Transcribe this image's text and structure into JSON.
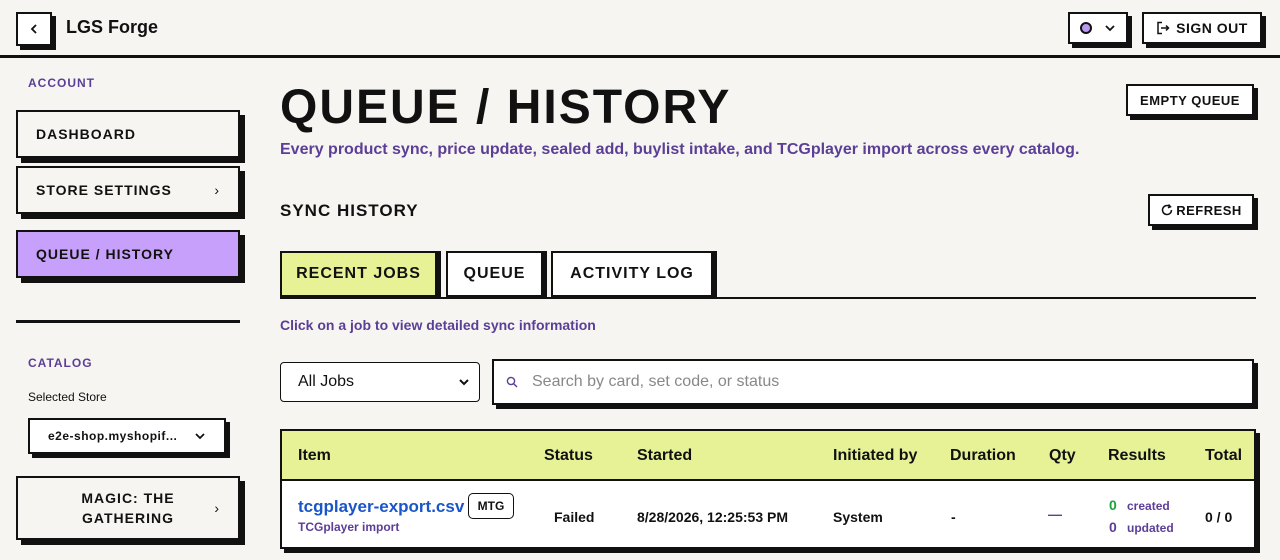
{
  "header": {
    "title": "LGS Forge",
    "back_icon": "chevron-left-icon",
    "theme_toggle": {
      "dot_color": "#b89af0",
      "icon": "chevron-down-icon"
    },
    "sign_out_label": "SIGN OUT"
  },
  "sidebar": {
    "account_label": "ACCOUNT",
    "items": [
      {
        "label": "DASHBOARD"
      },
      {
        "label": "STORE SETTINGS"
      },
      {
        "label": "QUEUE / HISTORY"
      }
    ],
    "catalog_label": "CATALOG",
    "selected_store_label": "Selected Store",
    "selected_store_value": "e2e-shop.myshopif...",
    "catalog_items": [
      {
        "label": "MAGIC: THE GATHERING"
      }
    ]
  },
  "main": {
    "title": "QUEUE / HISTORY",
    "subtitle": "Every product sync, price update, sealed add, buylist intake, and TCGplayer import across every catalog.",
    "empty_queue_label": "EMPTY QUEUE",
    "section_title": "SYNC HISTORY",
    "refresh_label": "REFRESH",
    "tabs": [
      {
        "label": "RECENT JOBS",
        "active": true
      },
      {
        "label": "QUEUE",
        "active": false
      },
      {
        "label": "ACTIVITY LOG",
        "active": false
      }
    ],
    "hint": "Click on a job to view detailed sync information",
    "filter": {
      "selected": "All Jobs"
    },
    "search": {
      "placeholder": "Search by card, set code, or status"
    },
    "table": {
      "columns": [
        "Item",
        "Status",
        "Started",
        "Initiated by",
        "Duration",
        "Qty",
        "Results",
        "Total"
      ],
      "rows": [
        {
          "item": "tcgplayer-export.csv",
          "badge": "MTG",
          "item_sub": "TCGplayer import",
          "status": "Failed",
          "started": "8/28/2026, 12:25:53 PM",
          "initiated_by": "System",
          "duration": "-",
          "qty": "—",
          "created_count": "0",
          "created_label": "created",
          "updated_count": "0",
          "updated_label": "updated",
          "total": "0 / 0"
        }
      ]
    }
  },
  "colors": {
    "accent_purple": "#c6a0fb",
    "accent_lime": "#e7f196",
    "text_purple": "#5b3e96",
    "link_blue": "#1a56c9",
    "success_green": "#1aa33b"
  }
}
